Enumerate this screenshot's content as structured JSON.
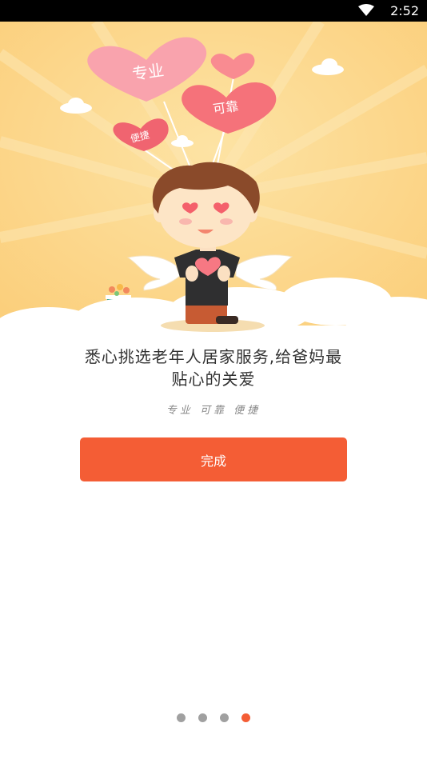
{
  "status_bar": {
    "time": "2:52",
    "icons": [
      "wifi-icon"
    ]
  },
  "hero": {
    "balloons": [
      "专业",
      "可靠",
      "便捷"
    ]
  },
  "tagline": {
    "line1": "悉心挑选老年人居家服务,给爸妈最",
    "line2": "贴心的关爱"
  },
  "subtagline": "专业 可靠 便捷",
  "done_button": {
    "label": "完成"
  },
  "pager": {
    "total": 4,
    "active_index": 4
  },
  "colors": {
    "accent": "#f45d35",
    "hero_background": "#fcd485",
    "dot_inactive": "#a0a0a0"
  }
}
